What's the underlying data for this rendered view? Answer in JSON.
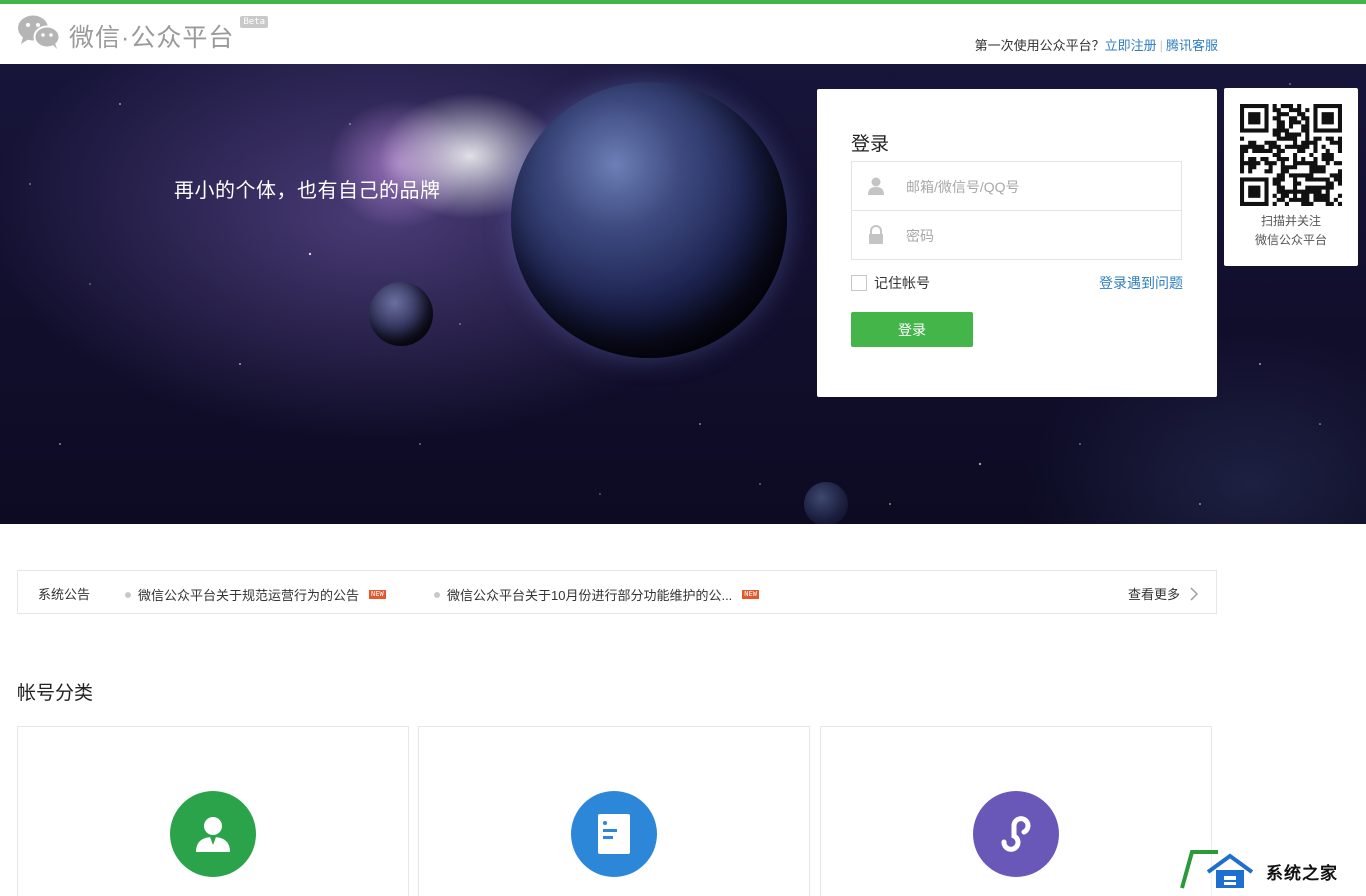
{
  "header": {
    "brand": "微信·公众平台",
    "badge": "Beta",
    "prompt": "第一次使用公众平台？",
    "register_link": "立即注册",
    "separator": "|",
    "support_link": "腾讯客服"
  },
  "banner": {
    "slogan": "再小的个体，也有自己的品牌"
  },
  "login": {
    "title": "登录",
    "account_placeholder": "邮箱/微信号/QQ号",
    "password_placeholder": "密码",
    "remember_label": "记住帐号",
    "trouble_link": "登录遇到问题",
    "submit_label": "登录"
  },
  "qr": {
    "caption_line1": "扫描并关注",
    "caption_line2": "微信公众平台"
  },
  "notice": {
    "label": "系统公告",
    "items": [
      {
        "text": "微信公众平台关于规范运营行为的公告",
        "badge": "NEW"
      },
      {
        "text": "微信公众平台关于10月份进行部分功能维护的公...",
        "badge": "NEW"
      }
    ],
    "more_label": "查看更多"
  },
  "categories": {
    "title": "帐号分类",
    "cards": [
      {
        "icon": "person-icon",
        "color": "#2aa34a"
      },
      {
        "icon": "document-icon",
        "color": "#2d87d9"
      },
      {
        "icon": "mini-program-icon",
        "color": "#6a58b8"
      }
    ]
  },
  "watermark": {
    "text": "系统之家"
  },
  "colors": {
    "accent_green": "#44b549",
    "link_blue": "#2e7fc1"
  }
}
